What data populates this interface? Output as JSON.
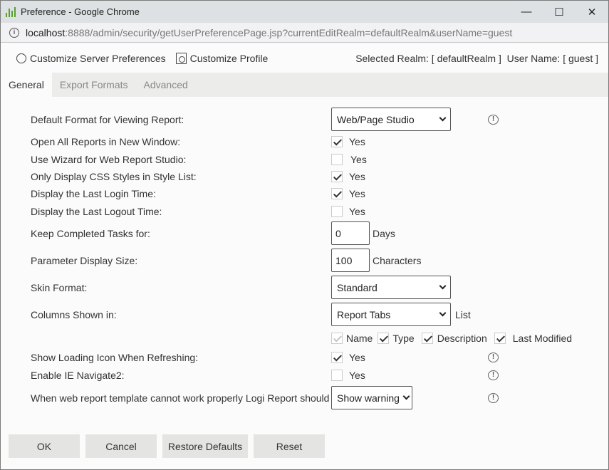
{
  "window": {
    "title": "Preference - Google Chrome",
    "minimize_label": "—",
    "maximize_label": "☐",
    "close_label": "✕"
  },
  "address": {
    "host": "localhost",
    "path": ":8888/admin/security/getUserPreferencePage.jsp?currentEditRealm=defaultRealm&userName=guest"
  },
  "toolbar": {
    "server_prefs_label": "Customize Server Preferences",
    "profile_label": "Customize Profile",
    "realm_info": "Selected Realm: [ defaultRealm ]  User Name: [ guest ]"
  },
  "tabs": [
    {
      "label": "General",
      "active": true
    },
    {
      "label": "Export Formats",
      "active": false
    },
    {
      "label": "Advanced",
      "active": false
    }
  ],
  "settings": {
    "default_format": {
      "label": "Default Format for Viewing Report:",
      "value": "Web/Page Studio"
    },
    "open_new_window": {
      "label": "Open All Reports in New Window:",
      "checked": true,
      "option": "Yes"
    },
    "use_wizard": {
      "label": "Use Wizard for Web Report Studio:",
      "checked": false,
      "option": "Yes"
    },
    "css_styles": {
      "label": "Only Display CSS Styles in Style List:",
      "checked": true,
      "option": "Yes"
    },
    "last_login": {
      "label": "Display the Last Login Time:",
      "checked": true,
      "option": "Yes"
    },
    "last_logout": {
      "label": "Display the Last Logout Time:",
      "checked": false,
      "option": "Yes"
    },
    "keep_tasks": {
      "label": "Keep Completed Tasks for:",
      "value": "0",
      "unit": "Days"
    },
    "param_size": {
      "label": "Parameter Display Size:",
      "value": "100",
      "unit": "Characters"
    },
    "skin": {
      "label": "Skin Format:",
      "value": "Standard"
    },
    "columns": {
      "label": "Columns Shown in:",
      "value": "Report Tabs",
      "unit": "List",
      "options": [
        {
          "label": "Name",
          "checked": true,
          "disabled": true
        },
        {
          "label": "Type",
          "checked": true,
          "disabled": false
        },
        {
          "label": "Description",
          "checked": true,
          "disabled": false
        },
        {
          "label": "Last Modified",
          "checked": true,
          "disabled": false
        }
      ]
    },
    "loading_icon": {
      "label": "Show Loading Icon When Refreshing:",
      "checked": true,
      "option": "Yes"
    },
    "ie_navigate": {
      "label": "Enable IE Navigate2:",
      "checked": false,
      "option": "Yes"
    },
    "template_warning": {
      "label": "When web report template cannot work properly Logi Report should",
      "value": "Show warning"
    }
  },
  "buttons": {
    "ok": "OK",
    "cancel": "Cancel",
    "restore": "Restore Defaults",
    "reset": "Reset"
  },
  "help_icon_glyph": "!"
}
